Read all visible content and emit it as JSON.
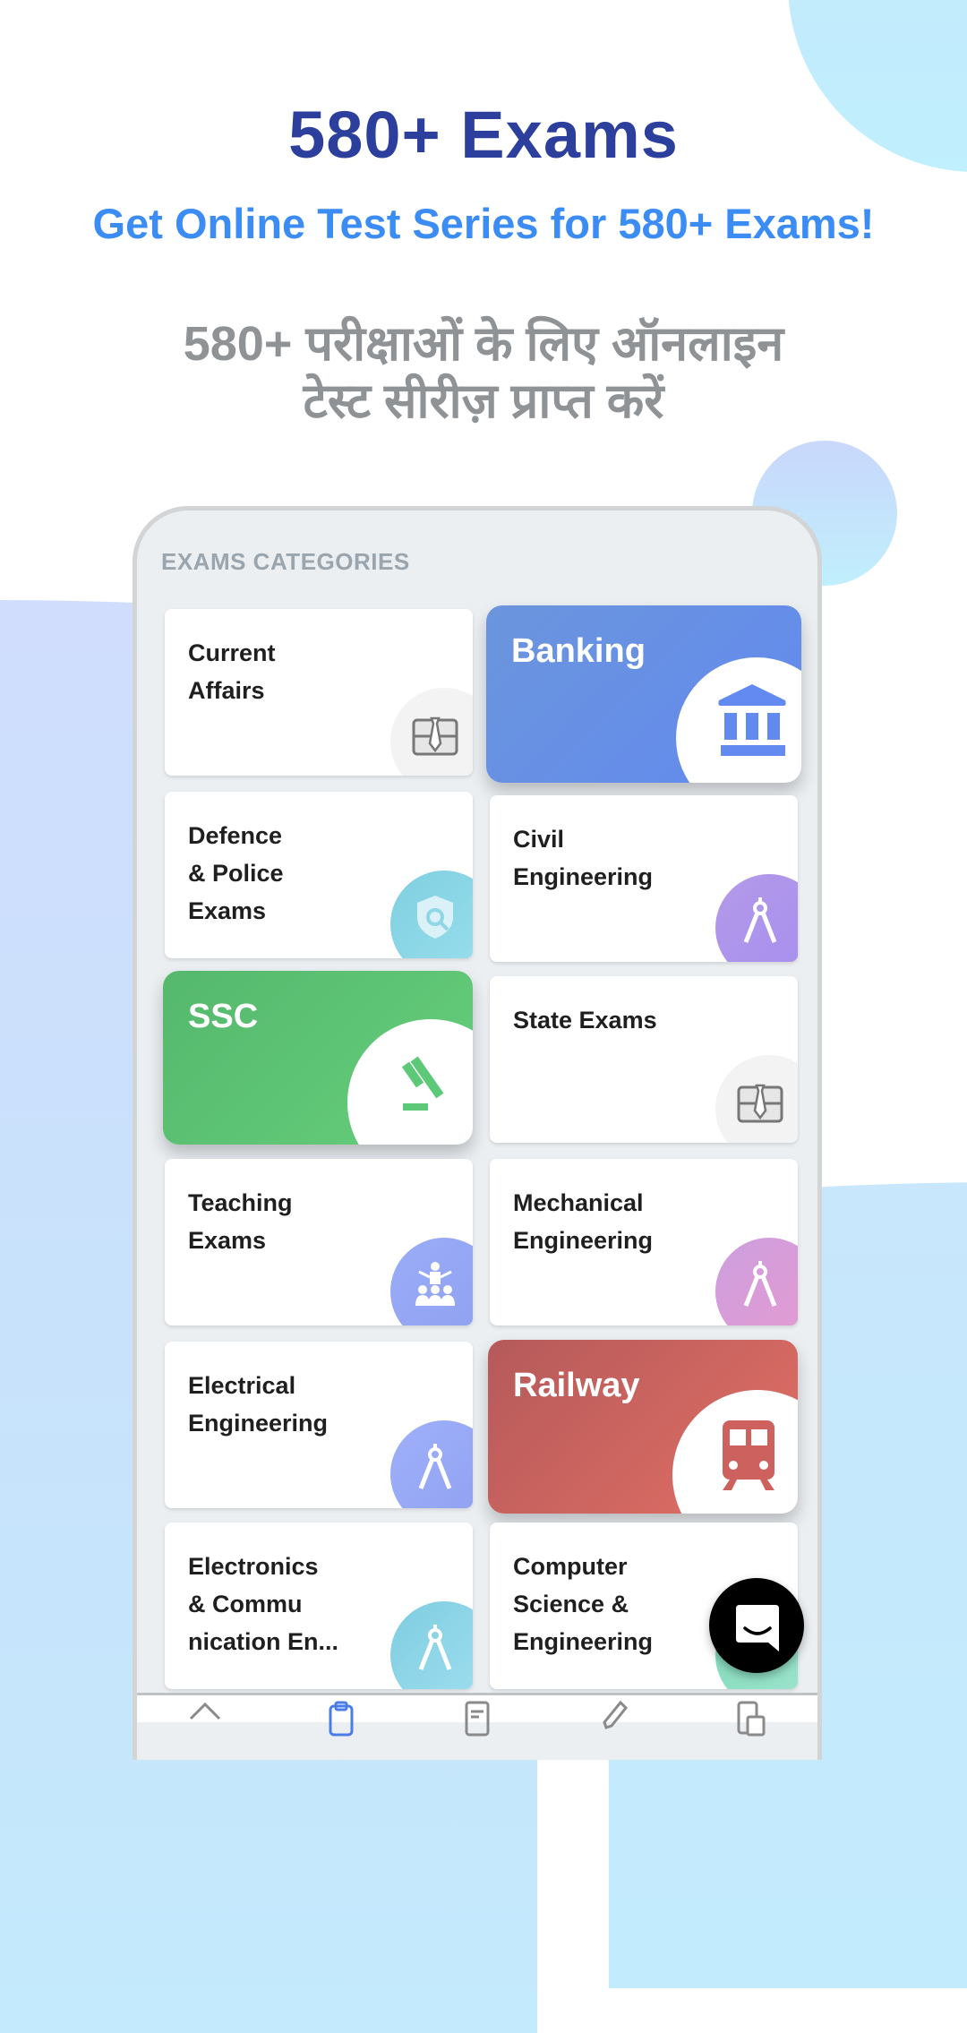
{
  "header": {
    "title": "580+ Exams",
    "subtitle": "Get Online Test Series for 580+ Exams!",
    "hindi_line1": "580+ परीक्षाओं के लिए ऑनलाइन",
    "hindi_line2": "टेस्ट सीरीज़ प्राप्त करें"
  },
  "colors": {
    "title": "#2c3f9c",
    "subtitle": "#3b8cf5",
    "banking": "#628af0",
    "ssc": "#5cc878",
    "railway": "#cc615d"
  },
  "section": {
    "title": "EXAMS CATEGORIES"
  },
  "categories": [
    {
      "label": "Current\nAffairs",
      "icon": "briefcase-icon",
      "featured": false
    },
    {
      "label": "Banking",
      "icon": "bank-icon",
      "featured": true
    },
    {
      "label": "Defence\n& Police\nExams",
      "icon": "shield-search-icon",
      "featured": false
    },
    {
      "label": "Civil\nEngineering",
      "icon": "compass-icon",
      "featured": false
    },
    {
      "label": "SSC",
      "icon": "gavel-icon",
      "featured": true
    },
    {
      "label": "State Exams",
      "icon": "briefcase-icon",
      "featured": false
    },
    {
      "label": "Teaching\nExams",
      "icon": "teacher-icon",
      "featured": false
    },
    {
      "label": "Mechanical\nEngineering",
      "icon": "compass-icon",
      "featured": false
    },
    {
      "label": "Electrical\nEngineering",
      "icon": "compass-icon",
      "featured": false
    },
    {
      "label": "Railway",
      "icon": "train-icon",
      "featured": true
    },
    {
      "label": "Electronics\n& Commu\nnication En...",
      "icon": "compass-icon",
      "featured": false
    },
    {
      "label": "Computer\nScience &\nEngineering",
      "icon": "compass-icon",
      "featured": false
    }
  ],
  "bottom_nav": [
    {
      "icon": "home-icon",
      "active": false
    },
    {
      "icon": "clipboard-icon",
      "active": true
    },
    {
      "icon": "document-icon",
      "active": false
    },
    {
      "icon": "pen-icon",
      "active": false
    },
    {
      "icon": "devices-icon",
      "active": false
    }
  ],
  "chat": {
    "icon": "chat-icon"
  }
}
